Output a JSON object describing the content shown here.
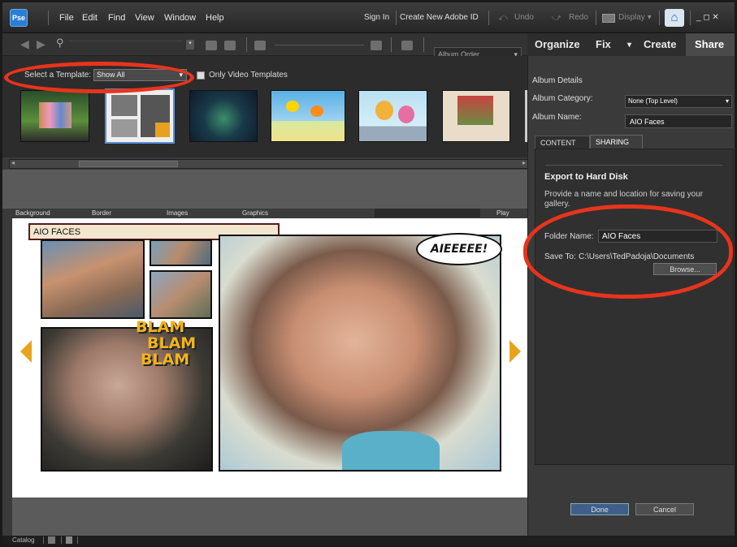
{
  "menubar": {
    "logo": "Pse",
    "items": [
      "File",
      "Edit",
      "Find",
      "View",
      "Window",
      "Help"
    ],
    "sign_in": "Sign In",
    "create_id": "Create New Adobe ID",
    "undo": "Undo",
    "redo": "Redo",
    "display": "Display ▾",
    "window_controls": "_ ◻ ✕"
  },
  "toolbar": {
    "album_order": "Album Order"
  },
  "templates": {
    "select_label": "Select a Template:",
    "select_value": "Show All",
    "video_only": "Only Video Templates"
  },
  "preview_tabs": {
    "background": "Background",
    "border": "Border",
    "images": "Images",
    "graphics": "Graphics",
    "play": "Play"
  },
  "gallery": {
    "title": "AIO FACES",
    "bubble": "AIEEEEE!",
    "sound": [
      "BLAM",
      "BLAM",
      "BLAM"
    ]
  },
  "panel": {
    "tabs": [
      "Organize",
      "Fix",
      "Create",
      "Share"
    ],
    "album_details": "Album Details",
    "album_category_label": "Album Category:",
    "album_category_value": "None (Top Level)",
    "album_name_label": "Album Name:",
    "album_name_value": "AIO Faces",
    "sub_tabs": [
      "CONTENT",
      "SHARING"
    ],
    "export_title": "Export to Hard Disk",
    "export_desc": "Provide a name and location for saving your gallery.",
    "folder_label": "Folder Name:",
    "folder_value": "AIO Faces",
    "save_label": "Save To:",
    "save_path": "C:\\Users\\TedPadoja\\Documents",
    "browse": "Browse...",
    "done": "Done",
    "cancel": "Cancel"
  },
  "status": {
    "catalog": "Catalog"
  },
  "colors": {
    "annotation": "#e8341c",
    "accent": "#2b7fd3"
  }
}
